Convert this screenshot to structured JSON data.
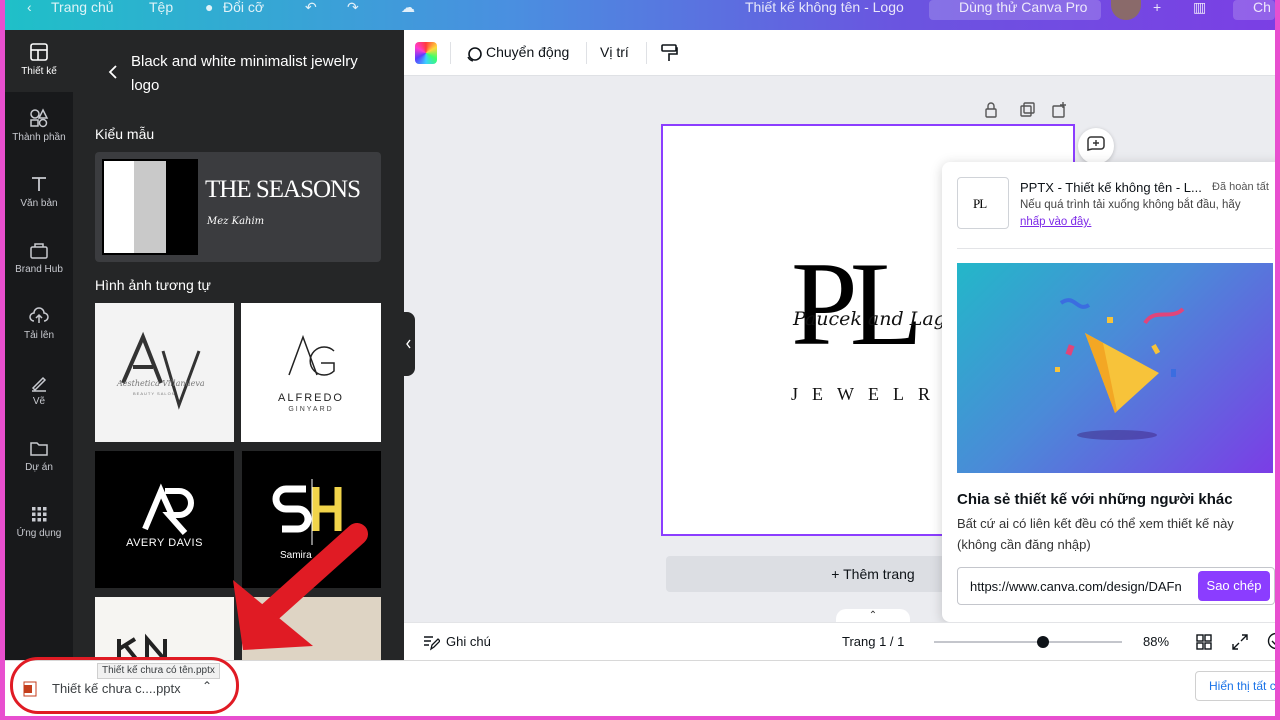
{
  "topbar": {
    "home": "Trang chủ",
    "file": "Tệp",
    "resize": "Đổi cỡ",
    "doc_title": "Thiết kế không tên - Logo",
    "trial": "Dùng thử Canva Pro",
    "share_partial": "Ch"
  },
  "rail": {
    "items": [
      {
        "label": "Thiết kế",
        "icon": "layout-icon"
      },
      {
        "label": "Thành phần",
        "icon": "shapes-icon"
      },
      {
        "label": "Văn bản",
        "icon": "text-icon"
      },
      {
        "label": "Brand Hub",
        "icon": "brand-icon"
      },
      {
        "label": "Tải lên",
        "icon": "upload-icon"
      },
      {
        "label": "Vẽ",
        "icon": "draw-icon"
      },
      {
        "label": "Dự án",
        "icon": "folder-icon"
      },
      {
        "label": "Ứng dụng",
        "icon": "apps-icon"
      }
    ]
  },
  "panel": {
    "title": "Black and white minimalist jewelry logo",
    "templates_label": "Kiểu mẫu",
    "template_text": "THE SEASONS",
    "template_script": "Mez Kahim",
    "similar_label": "Hình ảnh tương tự",
    "thumbs": {
      "av_script": "Aesthetica Villanueva",
      "av_sub": "BEAUTY SALON",
      "alfredo_name": "ALFREDO",
      "alfredo_sub": "GINYARD",
      "avery": "AVERY DAVIS",
      "samira": "Samira"
    }
  },
  "toolbar": {
    "animate": "Chuyển động",
    "position": "Vị trí"
  },
  "canvas": {
    "logo_initials": "PL",
    "logo_script": "Paucek and Lage",
    "logo_word": "JEWELRY",
    "add_page": "+ Thêm trang"
  },
  "popup": {
    "dl_title": "PPTX - Thiết kế không tên - L...",
    "dl_status": "Đã hoàn tất",
    "dl_msg": "Nếu quá trình tải xuống không bắt đầu, hãy",
    "dl_link": "nhấp vào đây.",
    "share_title": "Chia sẻ thiết kế với những người khác",
    "share_desc": "Bất cứ ai có liên kết đều có thể xem thiết kế này (không cần đăng nhập)",
    "share_url": "https://www.canva.com/design/DAFn",
    "copy": "Sao chép"
  },
  "bottombar": {
    "notes": "Ghi chú",
    "page": "Trang 1 / 1",
    "zoom": "88%",
    "zoom_fraction": 0.55
  },
  "downloads": {
    "filename": "Thiết kế chưa c....pptx",
    "tooltip": "Thiết kế chưa có tên.pptx",
    "show_all": "Hiển thị tất cả"
  },
  "colors": {
    "accent": "#8b3dff",
    "annotation_red": "#e01b24"
  }
}
